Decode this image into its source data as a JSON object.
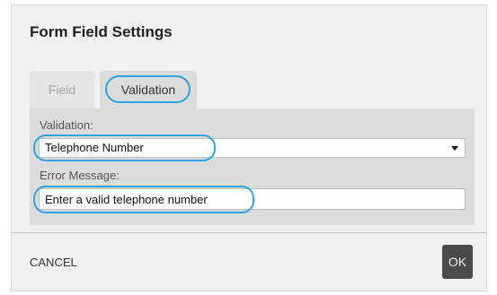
{
  "dialog": {
    "title": "Form Field Settings"
  },
  "tabs": [
    {
      "label": "Field",
      "active": false
    },
    {
      "label": "Validation",
      "active": true
    }
  ],
  "validation": {
    "label": "Validation:",
    "selected": "Telephone Number"
  },
  "error_message": {
    "label": "Error Message:",
    "value": "Enter a valid telephone number"
  },
  "footer": {
    "cancel_label": "CANCEL",
    "ok_label": "OK"
  },
  "colors": {
    "highlight": "#2aa7e6",
    "ok_button": "#4a4a4a"
  }
}
